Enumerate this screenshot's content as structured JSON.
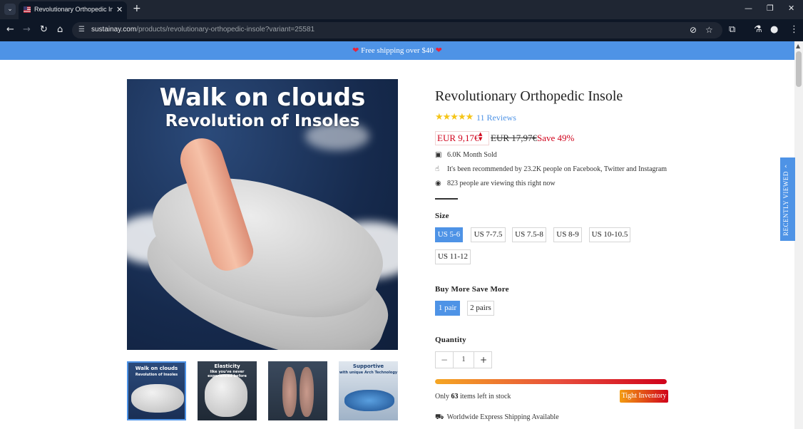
{
  "browser": {
    "tab_title": "Revolutionary Orthopedic Insole",
    "url_host": "sustainay.com",
    "url_path": "/products/revolutionary-orthopedic-insole?variant=25581",
    "new_tab_label": "+",
    "close_tab_label": "✕"
  },
  "banner": {
    "text": "Free shipping over $40"
  },
  "product": {
    "title": "Revolutionary Orthopedic Insole",
    "rating": 5,
    "stars": "★★★★★",
    "reviews_label": "11 Reviews",
    "price": "EUR 9,17€",
    "compare_price": "EUR 17,97€",
    "save_label": "Save 49%",
    "main_image": {
      "headline": "Walk on clouds",
      "subheadline": "Revolution of Insoles"
    },
    "thumbnails": [
      {
        "caption": "Walk on clouds",
        "sub": "Revolution of Insoles"
      },
      {
        "caption": "Elasticity",
        "sub": "like you've never experienced before"
      },
      {
        "caption": "",
        "sub": ""
      },
      {
        "caption": "Supportive",
        "sub": "with unique Arch Technology"
      }
    ]
  },
  "info": {
    "sold": "6.0K Month Sold",
    "recommended": "It's been recommended by 23.2K people on Facebook, Twitter and Instagram",
    "viewing": "823 people are viewing this right now"
  },
  "size": {
    "label": "Size",
    "options": [
      "US 5-6",
      "US 7-7.5",
      "US 7.5-8",
      "US 8-9",
      "US 10-10.5",
      "US 11-12"
    ],
    "selected": "US 5-6"
  },
  "bundle": {
    "label": "Buy More Save More",
    "options": [
      "1 pair",
      "2 pairs"
    ],
    "selected": "1 pair"
  },
  "quantity": {
    "label": "Quantity",
    "value": "1",
    "minus": "−",
    "plus": "+"
  },
  "stock": {
    "prefix": "Only ",
    "count": "63",
    "suffix": " items left in stock",
    "badge": "Tight Inventory"
  },
  "shipping": {
    "text": "Worldwide Express Shipping Available"
  },
  "recently_viewed": {
    "label": "RECENTLY VIEWED"
  },
  "colors": {
    "accent": "#4e93e6",
    "price_red": "#d0021b",
    "star": "#f5c518"
  }
}
